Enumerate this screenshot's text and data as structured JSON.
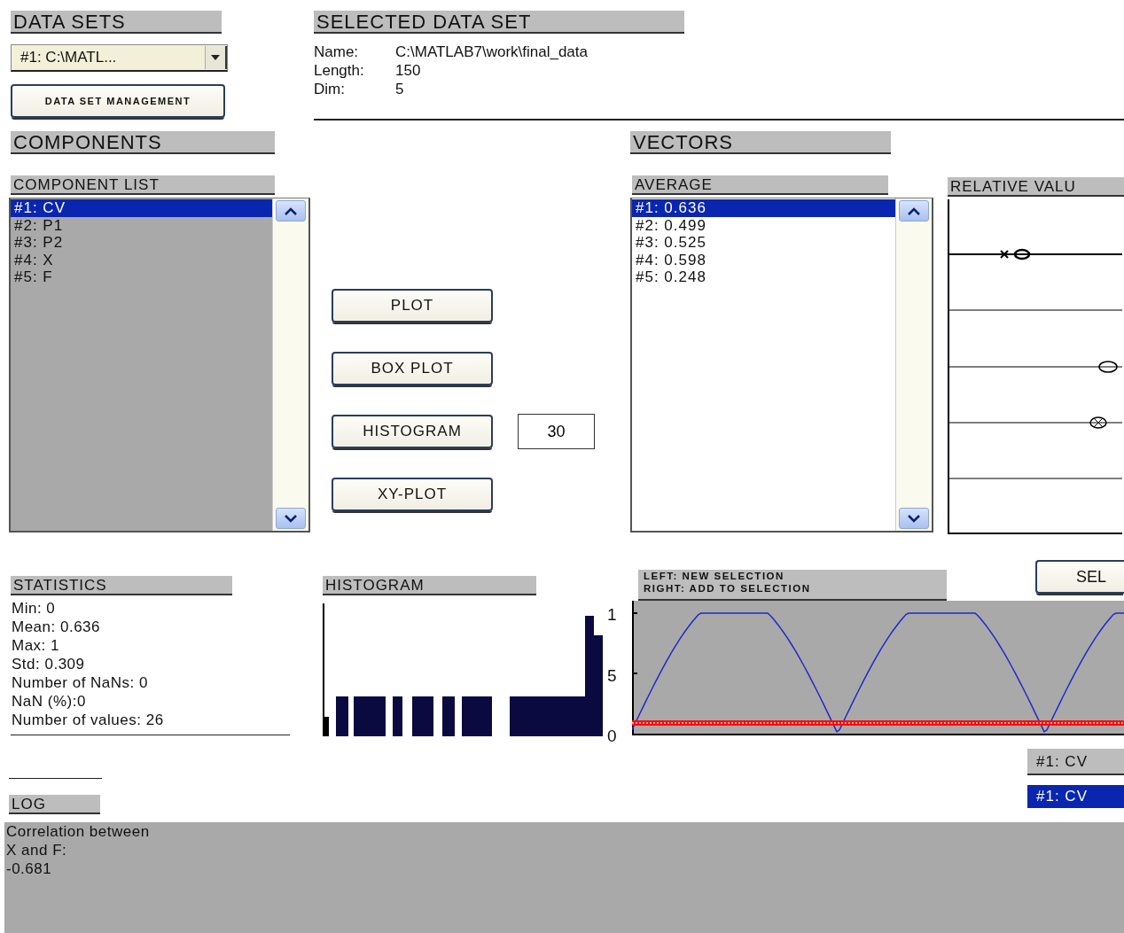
{
  "data_sets": {
    "header": "DATA SETS",
    "dropdown": {
      "value": "#1: C:\\MATL..."
    },
    "button": "DATA SET MANAGEMENT"
  },
  "selected_data_set": {
    "header": "SELECTED DATA SET",
    "fields": [
      {
        "label": "Name:",
        "value": "C:\\MATLAB7\\work\\final_data"
      },
      {
        "label": "Length:",
        "value": "150"
      },
      {
        "label": "Dim:",
        "value": "5"
      }
    ]
  },
  "components": {
    "header": "COMPONENTS",
    "list_header": "COMPONENT LIST",
    "items": [
      {
        "label": "#1: CV",
        "selected": true
      },
      {
        "label": "#2: P1",
        "selected": false
      },
      {
        "label": "#3: P2",
        "selected": false
      },
      {
        "label": "#4: X",
        "selected": false
      },
      {
        "label": "#5: F",
        "selected": false
      }
    ]
  },
  "actions": {
    "buttons": [
      "PLOT",
      "BOX PLOT",
      "HISTOGRAM",
      "XY-PLOT"
    ],
    "bins": {
      "value": "30"
    }
  },
  "vectors": {
    "header": "VECTORS",
    "average_header": "AVERAGE",
    "relative_header": "RELATIVE VALU",
    "items": [
      {
        "label": "#1: 0.636",
        "selected": true
      },
      {
        "label": "#2: 0.499",
        "selected": false
      },
      {
        "label": "#3: 0.525",
        "selected": false
      },
      {
        "label": "#4: 0.598",
        "selected": false
      },
      {
        "label": "#5: 0.248",
        "selected": false
      }
    ]
  },
  "statistics": {
    "header": "STATISTICS",
    "lines": [
      "Min: 0",
      "Mean: 0.636",
      "Max: 1",
      "Std: 0.309",
      "Number of NaNs: 0",
      "NaN (%):0",
      "Number of values: 26"
    ]
  },
  "histogram": {
    "header": "HISTOGRAM"
  },
  "selection_plot": {
    "hint": [
      "LEFT: NEW SELECTION",
      "RIGHT: ADD TO SELECTION"
    ],
    "y_ticks": [
      "1",
      "5",
      "0"
    ],
    "select_button": "SEL"
  },
  "component_indicators": [
    {
      "label": "#1: CV",
      "selected": false
    },
    {
      "label": "#1: CV",
      "selected": true
    }
  ],
  "log": {
    "header": "LOG",
    "lines": [
      "Correlation between",
      "X and F:",
      "-0.681"
    ]
  }
}
